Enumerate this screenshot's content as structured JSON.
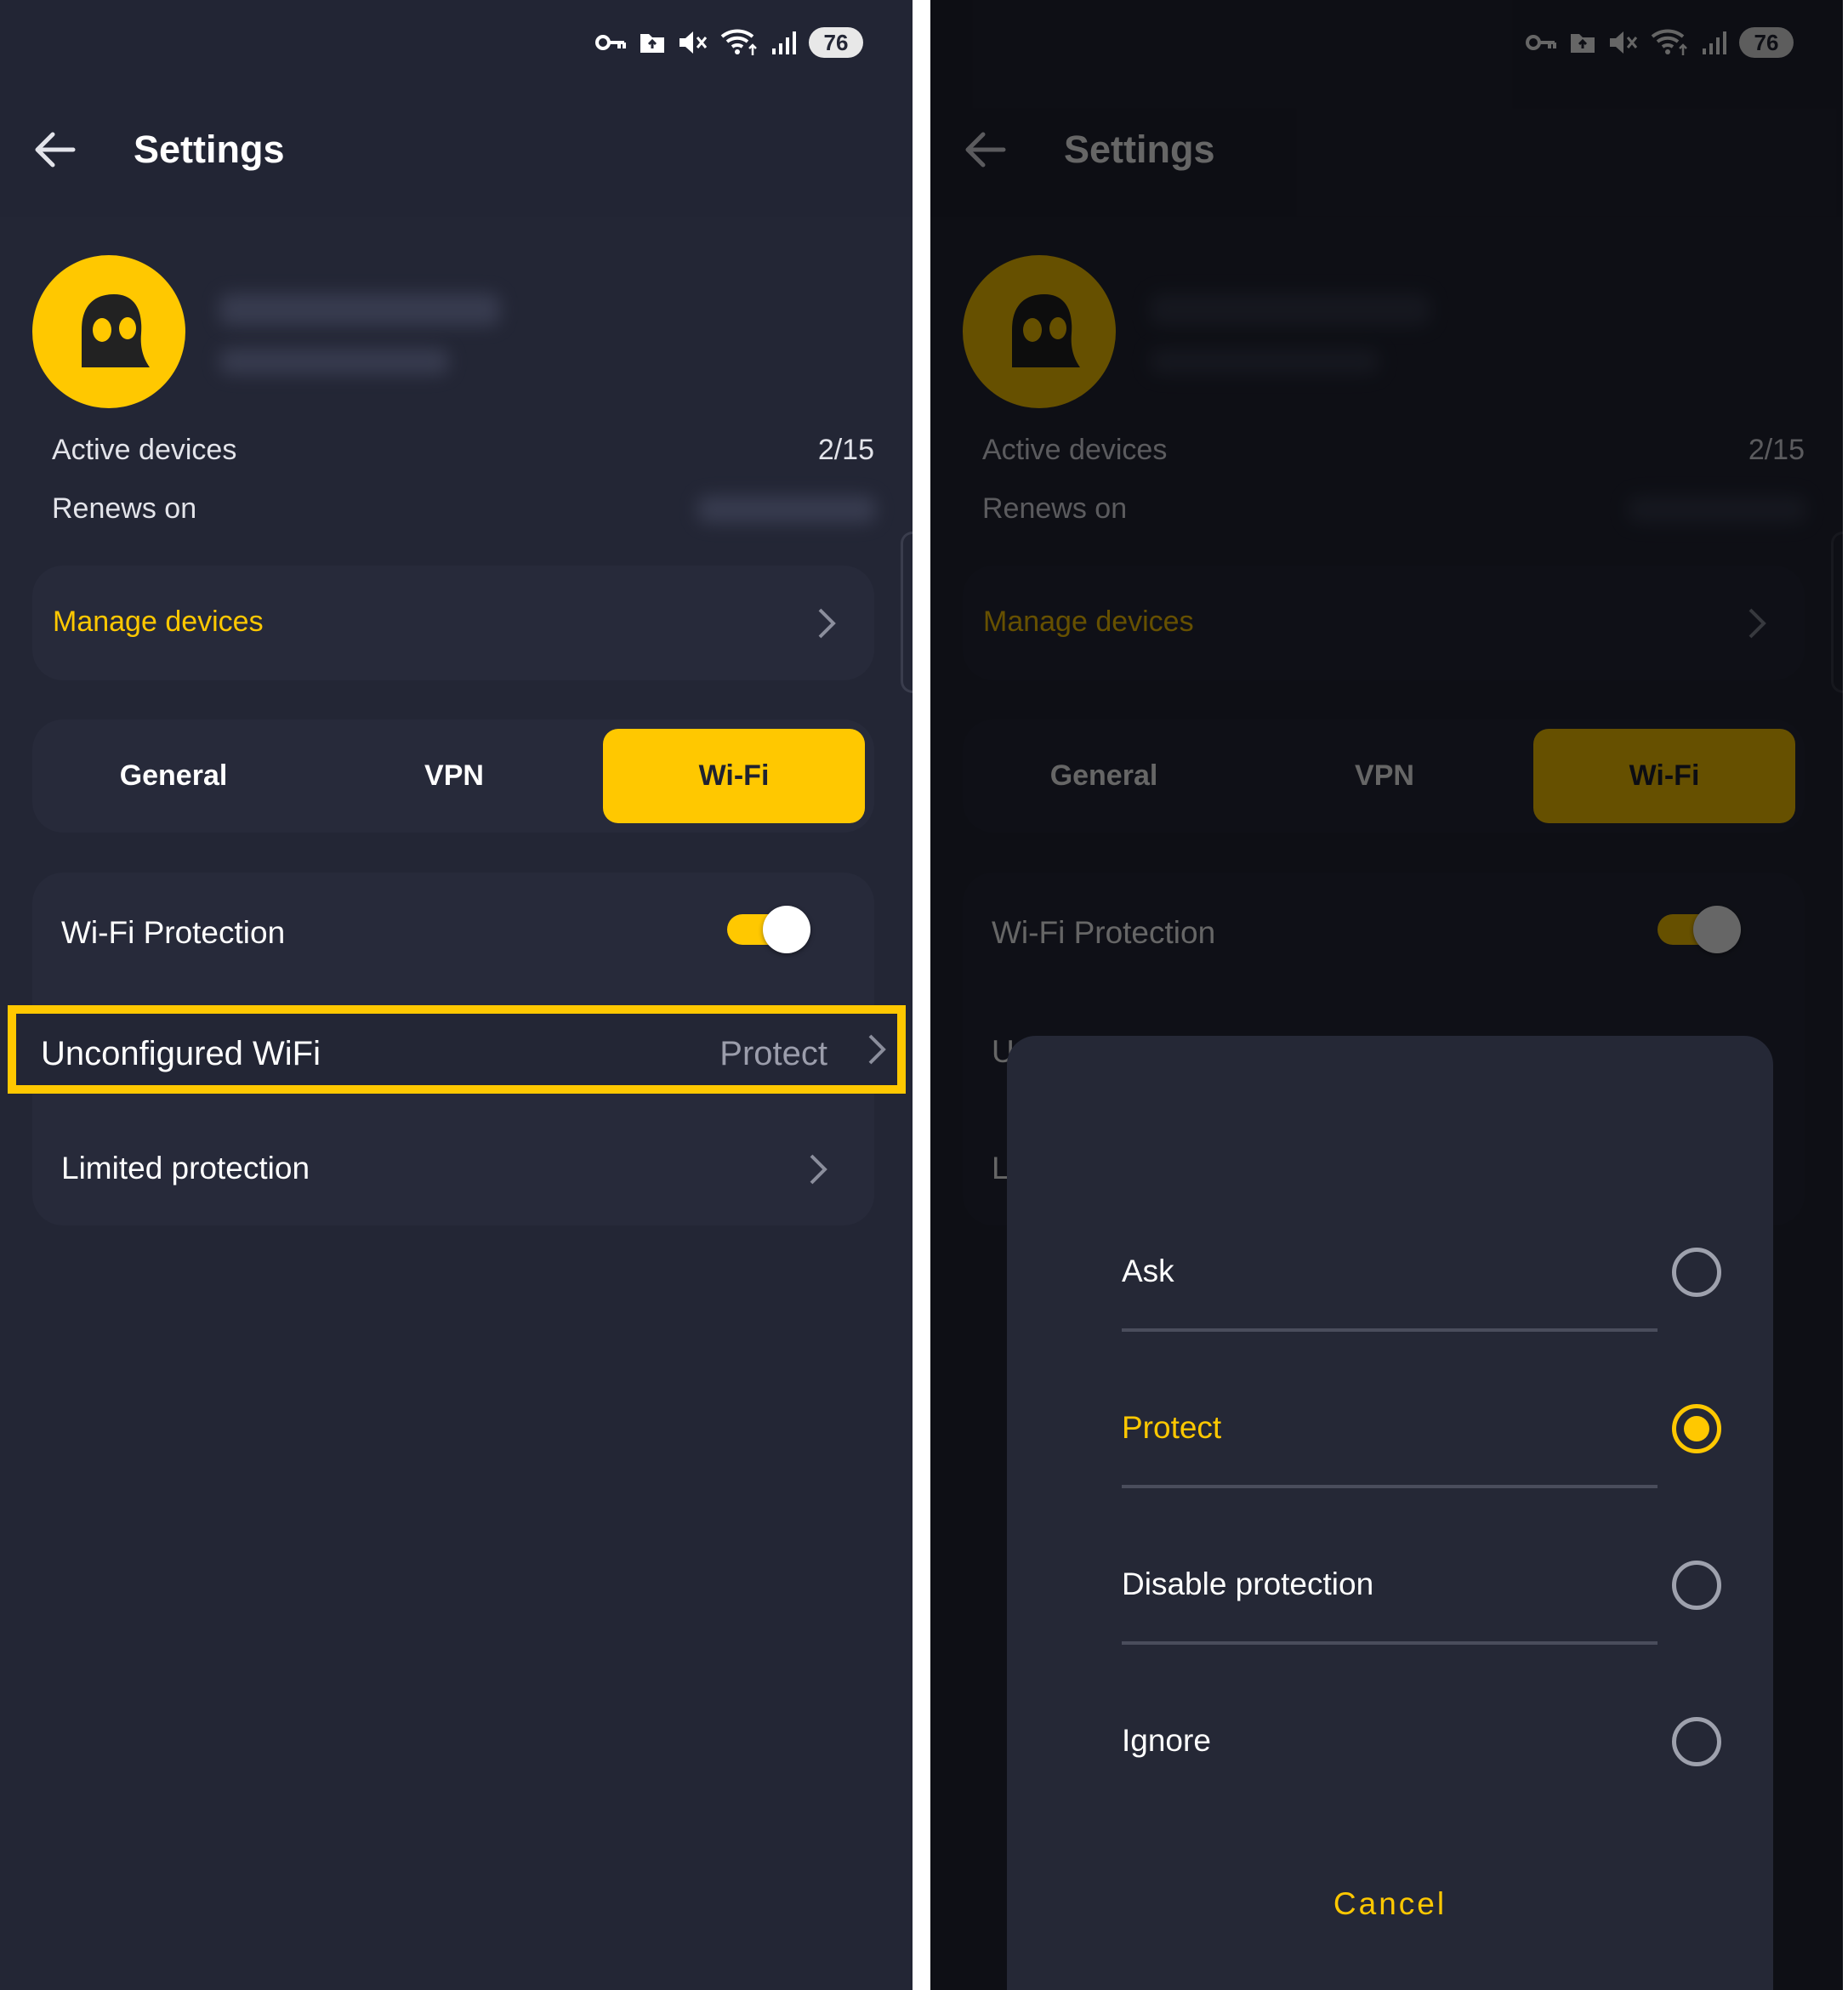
{
  "status_bar": {
    "battery": "76"
  },
  "header": {
    "title": "Settings"
  },
  "account": {
    "active_devices_label": "Active devices",
    "active_devices_value": "2/15",
    "renews_label": "Renews on"
  },
  "manage_devices": {
    "label": "Manage devices"
  },
  "tabs": [
    {
      "label": "General"
    },
    {
      "label": "VPN"
    },
    {
      "label": "Wi-Fi"
    }
  ],
  "active_tab": "Wi-Fi",
  "wifi": {
    "protection_label": "Wi-Fi Protection",
    "protection_on": true,
    "unconfigured_label": "Unconfigured WiFi",
    "unconfigured_value": "Protect",
    "limited_label": "Limited protection"
  },
  "dialog": {
    "options": [
      {
        "label": "Ask",
        "selected": false
      },
      {
        "label": "Protect",
        "selected": true
      },
      {
        "label": "Disable protection",
        "selected": false
      },
      {
        "label": "Ignore",
        "selected": false
      }
    ],
    "cancel_label": "Cancel"
  },
  "colors": {
    "accent": "#ffc800",
    "background": "#232635",
    "card": "#272a3a",
    "highlight_border": "#ffc800"
  }
}
